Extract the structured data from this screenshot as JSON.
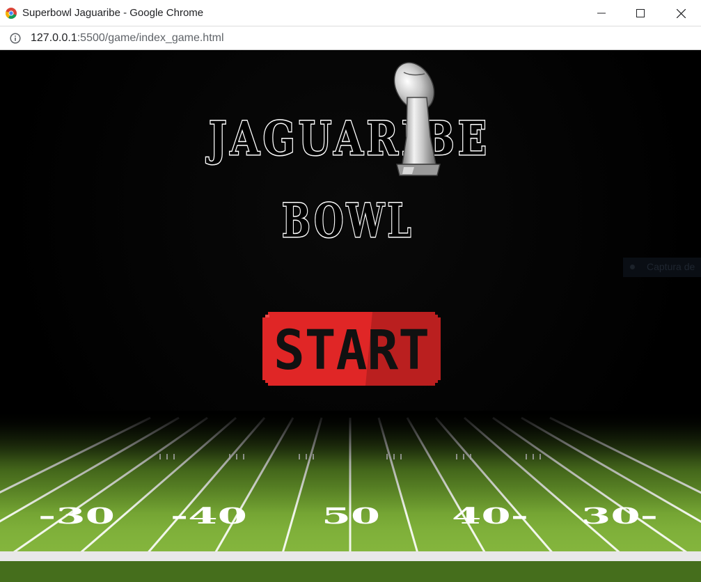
{
  "window": {
    "title": "Superbowl Jaguaribe - Google Chrome",
    "icons": [
      "chrome-logo-icon",
      "minimize-icon",
      "maximize-icon",
      "close-icon"
    ]
  },
  "address_bar": {
    "host": "127.0.0.1",
    "path": ":5500/game/index_game.html",
    "info_icon": "info-icon"
  },
  "game": {
    "title_line1": "JAGUARIBE",
    "title_line2": "BOWL",
    "start_label": "START",
    "colors": {
      "start_red": "#e02626",
      "start_dark": "#b31f1f",
      "field_green": "#7fb03a",
      "yard_text": "#ffffff"
    },
    "yard_markers": [
      "-30",
      "-40",
      "50",
      "40-",
      "30-"
    ],
    "overlay_tip": "Captura de"
  }
}
